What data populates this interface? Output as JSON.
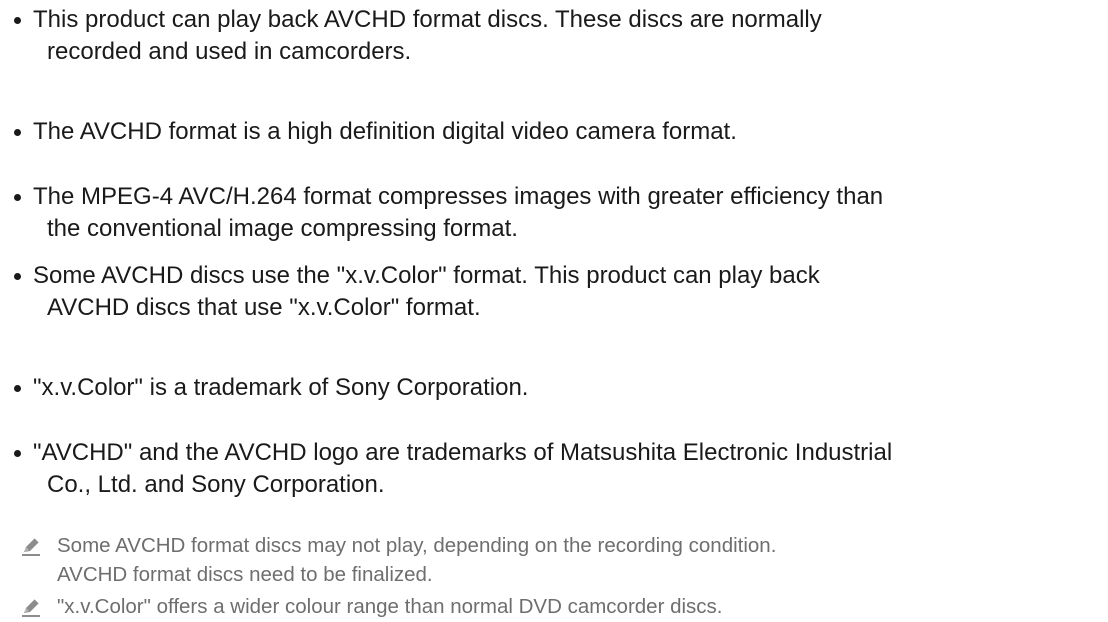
{
  "bullets": [
    {
      "line1": "This product can play back AVCHD format discs. These discs are normally",
      "line2": "recorded and used in camcorders."
    },
    {
      "line1": "The AVCHD format is a high definition digital video camera format."
    },
    {
      "line1": "The MPEG-4 AVC/H.264 format compresses images with greater efficiency than",
      "line2": "the conventional image compressing format."
    },
    {
      "line1": "Some AVCHD discs use the \"x.v.Color\" format. This product can play back",
      "line2": "AVCHD discs that use \"x.v.Color\" format."
    },
    {
      "line1": "\"x.v.Color\" is a trademark of Sony Corporation."
    },
    {
      "line1": "\"AVCHD\" and the AVCHD logo are trademarks of Matsushita Electronic Industrial",
      "line2": "Co., Ltd. and Sony Corporation."
    }
  ],
  "notes": [
    {
      "icon": "pencil-icon",
      "line1": "Some AVCHD format discs may not play, depending on the recording condition.",
      "line2": "AVCHD format discs need to be finalized."
    },
    {
      "icon": "pencil-icon",
      "line1": "\"x.v.Color\" offers a wider colour range than normal DVD camcorder discs."
    }
  ],
  "colors": {
    "text": "#1a1a1a",
    "note_text": "#6e6e6e",
    "icon": "#8c8c8c"
  }
}
